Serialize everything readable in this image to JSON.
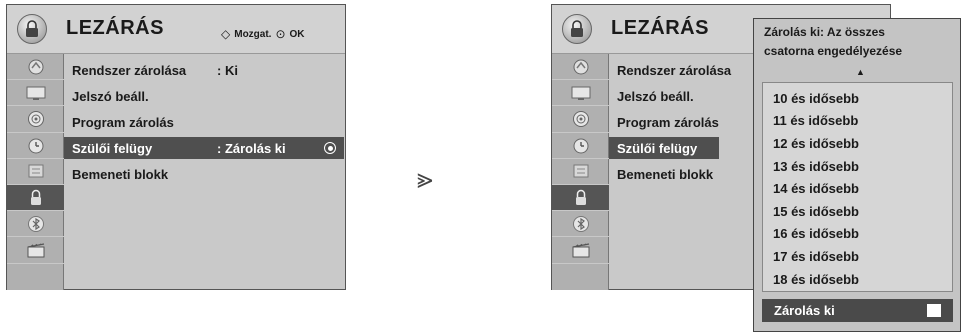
{
  "left_panel": {
    "title": "LEZÁRÁS",
    "hint": {
      "move": "Mozgat.",
      "ok": "OK"
    },
    "items": [
      {
        "label": "Rendszer zárolása",
        "value": ": Ki"
      },
      {
        "label": "Jelszó beáll.",
        "value": ""
      },
      {
        "label": "Program zárolás",
        "value": ""
      },
      {
        "label": "Szülői felügy",
        "value": ": Zárolás ki"
      },
      {
        "label": "Bemeneti blokk",
        "value": ""
      }
    ]
  },
  "right_panel": {
    "title": "LEZÁRÁS",
    "items": [
      {
        "label": "Rendszer zárolása"
      },
      {
        "label": "Jelszó beáll."
      },
      {
        "label": "Program zárolás"
      },
      {
        "label": "Szülői felügy"
      },
      {
        "label": "Bemeneti blokk"
      }
    ]
  },
  "sidebar_icons": [
    "setup-icon",
    "picture-icon",
    "audio-icon",
    "time-icon",
    "option-icon",
    "lock-icon",
    "bluetooth-icon",
    "media-icon"
  ],
  "popup": {
    "description_line1": "Zárolás ki: Az összes",
    "description_line2": "csatorna engedélyezése",
    "options": [
      "10 és idősebb",
      "11 és idősebb",
      "12 és idősebb",
      "13 és idősebb",
      "14 és idősebb",
      "15 és idősebb",
      "16 és idősebb",
      "17 és idősebb",
      "18 és idősebb"
    ],
    "selected": "Zárolás ki"
  },
  "colors": {
    "panel": "#c9c9c9",
    "highlight": "#4f4f4f",
    "sidebar": "#b0b0b0"
  }
}
